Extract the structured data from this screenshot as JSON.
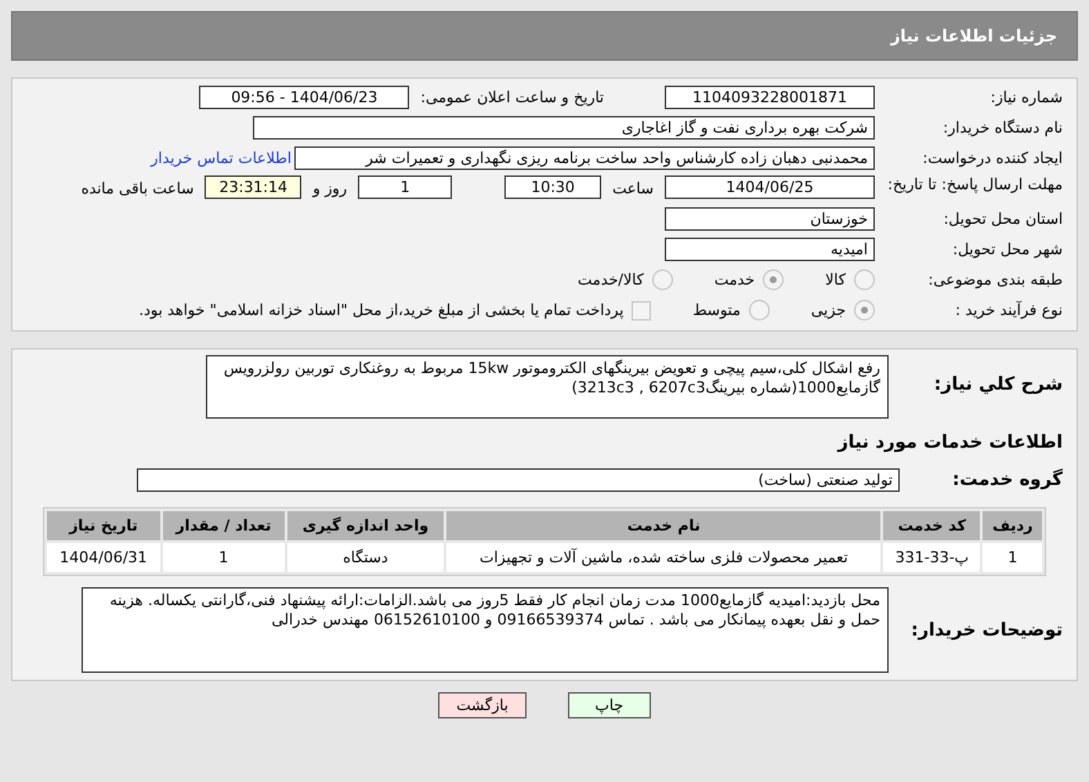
{
  "header": {
    "title": "جزئیات اطلاعات نیاز"
  },
  "need_number": {
    "label": "شماره نیاز:",
    "value": "1104093228001871"
  },
  "announce": {
    "label": "تاریخ و ساعت اعلان عمومی:",
    "value": "1404/06/23 - 09:56"
  },
  "buyer": {
    "label": "نام دستگاه خریدار:",
    "value": "شرکت بهره برداری نفت و گاز اغاجاری"
  },
  "creator": {
    "label": "ایجاد کننده درخواست:",
    "value": "محمدنبی دهبان زاده کارشناس واحد ساخت برنامه ریزی نگهداری  و تعمیرات شر",
    "link": "اطلاعات تماس خریدار"
  },
  "deadline": {
    "label": "مهلت ارسال پاسخ: تا تاریخ:",
    "date": "1404/06/25",
    "time_label": "ساعت",
    "time": "10:30",
    "days": "1",
    "days_label": "روز و",
    "remaining": "23:31:14",
    "remaining_label": "ساعت باقی مانده"
  },
  "province": {
    "label": "استان محل تحویل:",
    "value": "خوزستان"
  },
  "city": {
    "label": "شهر محل تحویل:",
    "value": "امیدیه"
  },
  "category": {
    "label": "طبقه بندی موضوعی:",
    "options": [
      {
        "label": "کالا",
        "selected": false
      },
      {
        "label": "خدمت",
        "selected": true
      },
      {
        "label": "کالا/خدمت",
        "selected": false
      }
    ]
  },
  "process": {
    "label": "نوع فرآیند خرید :",
    "options": [
      {
        "label": "جزیی",
        "selected": true
      },
      {
        "label": "متوسط",
        "selected": false
      }
    ],
    "payment": {
      "label": "پرداخت تمام یا بخشی از مبلغ خرید،از محل \"اسناد خزانه اسلامی\" خواهد بود.",
      "checked": false
    }
  },
  "description": {
    "label": "شرح کلي نياز:",
    "value": "رفع اشکال کلی،سیم پیچی و تعویض بیرینگهای الکتروموتور 15kw مربوط به روغنکاری توربین رولزرویس گازمایع1000(شماره بیرینگ3213c3 , 6207c3)"
  },
  "services_title": "اطلاعات خدمات مورد نیاز",
  "service_group": {
    "label": "گروه خدمت:",
    "value": "تولید صنعتی (ساخت)"
  },
  "table": {
    "columns": [
      "ردیف",
      "کد خدمت",
      "نام خدمت",
      "واحد اندازه گیری",
      "تعداد / مقدار",
      "تاریخ نیاز"
    ],
    "rows": [
      [
        "1",
        "پ-33-331",
        "تعمیر محصولات فلزی ساخته شده، ماشین آلات و تجهیزات",
        "دستگاه",
        "1",
        "1404/06/31"
      ]
    ]
  },
  "notes": {
    "label": "توضیحات خریدار:",
    "value": "محل بازدید:امیدیه گازمایع1000 مدت زمان انجام کار فقط 5روز می باشد.الزامات:ارائه پیشنهاد فنی،گارانتی یکساله. هزینه حمل و نقل بعهده پیمانکار می باشد . تماس 09166539374 و 06152610100 مهندس خدرالی"
  },
  "buttons": [
    {
      "kind": "print",
      "label": "چاپ"
    },
    {
      "kind": "back",
      "label": "بازگشت"
    }
  ]
}
